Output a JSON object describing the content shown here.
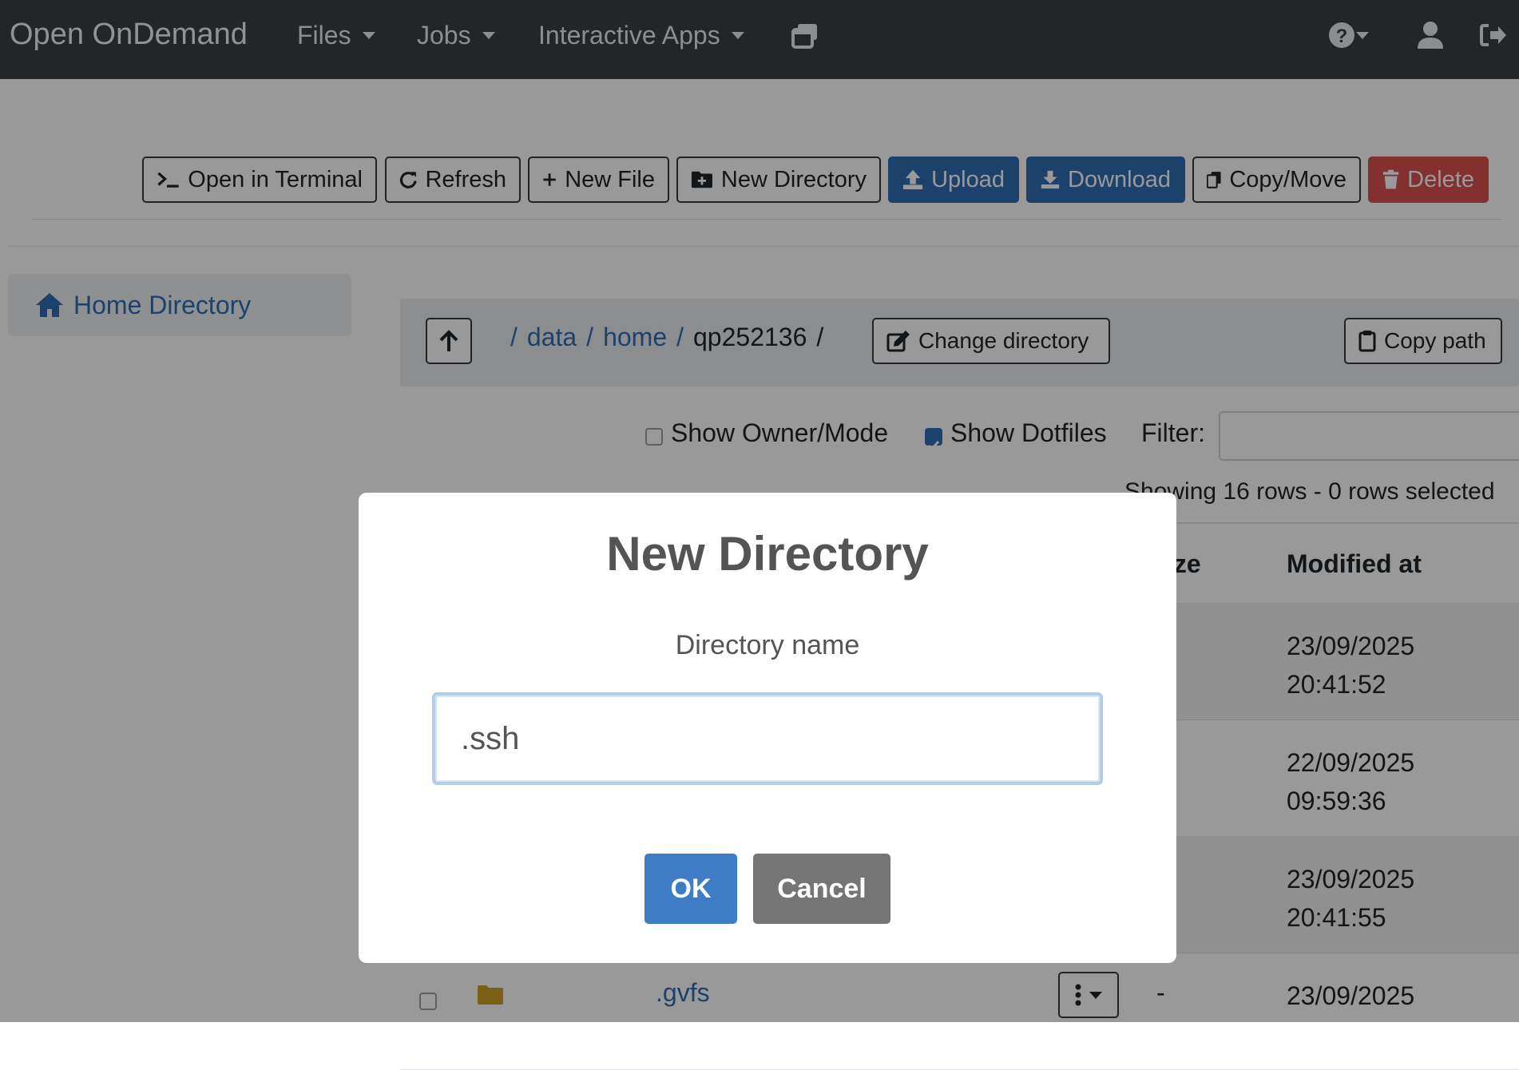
{
  "navbar": {
    "brand": "Open OnDemand",
    "menus": [
      "Files",
      "Jobs",
      "Interactive Apps"
    ],
    "icons": [
      "windows-icon",
      "help-icon",
      "user-icon",
      "logout-icon"
    ]
  },
  "toolbar": {
    "terminal": "Open in Terminal",
    "refresh": "Refresh",
    "new_file": "New File",
    "new_directory": "New Directory",
    "upload": "Upload",
    "download": "Download",
    "copy_move": "Copy/Move",
    "delete": "Delete"
  },
  "sidebar": {
    "home": "Home Directory"
  },
  "path": {
    "segments": [
      "data",
      "home",
      "qp252136"
    ],
    "separator": "/",
    "change_directory": "Change directory",
    "copy_path": "Copy path"
  },
  "options": {
    "show_owner_mode": "Show Owner/Mode",
    "show_owner_mode_checked": false,
    "show_dotfiles": "Show Dotfiles",
    "show_dotfiles_checked": true,
    "filter_label": "Filter:",
    "filter_value": ""
  },
  "table": {
    "status": "Showing 16 rows - 0 rows selected",
    "headers": {
      "size": "ize",
      "modified": "Modified at"
    },
    "rows": [
      {
        "name": "",
        "size": "",
        "modified_date": "23/09/2025",
        "modified_time": "20:41:52"
      },
      {
        "name": "",
        "size": "",
        "modified_date": "22/09/2025",
        "modified_time": "09:59:36"
      },
      {
        "name": "",
        "size": "",
        "modified_date": "23/09/2025",
        "modified_time": "20:41:55"
      },
      {
        "name": ".gvfs",
        "size": "-",
        "modified_date": "23/09/2025",
        "modified_time": ""
      }
    ]
  },
  "modal": {
    "title": "New Directory",
    "label": "Directory name",
    "input_value": ".ssh",
    "ok": "OK",
    "cancel": "Cancel"
  },
  "colors": {
    "navbar": "#3b3f44",
    "primary": "#2f6eb5",
    "danger": "#d9534f",
    "folder": "#c9a227"
  }
}
